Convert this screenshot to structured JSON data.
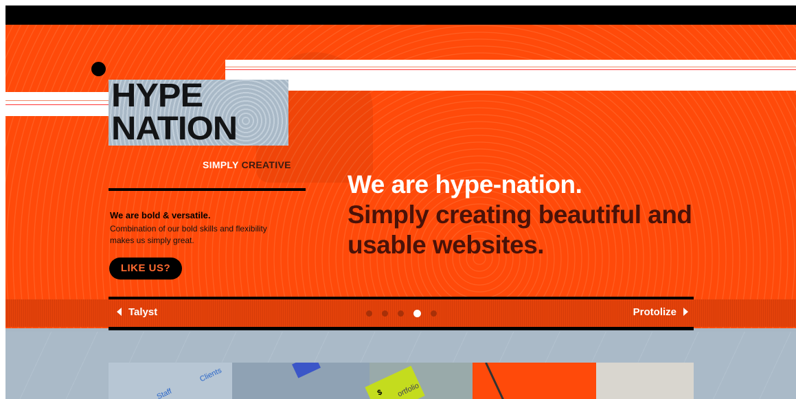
{
  "logo": {
    "line1": "HYPE",
    "line2": "NATION"
  },
  "tagline": {
    "part1": "SIMPLY",
    "part2": "CREATIVE"
  },
  "intro": {
    "heading": "We are bold & versatile.",
    "body": "Combination of our bold skills and flexibility makes us simply great.",
    "cta": "LIKE US?"
  },
  "hero": {
    "headline_white": "We are hype-nation.",
    "headline_dark": "Simply creating beautiful and usable websites."
  },
  "slider": {
    "prev_label": "Talyst",
    "next_label": "Protolize",
    "dot_count": 5,
    "active_index": 3
  },
  "preview": {
    "tag1": "Clients",
    "tag2": "Staff",
    "tag3": "$",
    "tag4": "ortfolio"
  },
  "colors": {
    "accent": "#ff4a0a",
    "dark": "#000000",
    "slate": "#a8b8c6",
    "headline_dark": "#4a1208"
  }
}
